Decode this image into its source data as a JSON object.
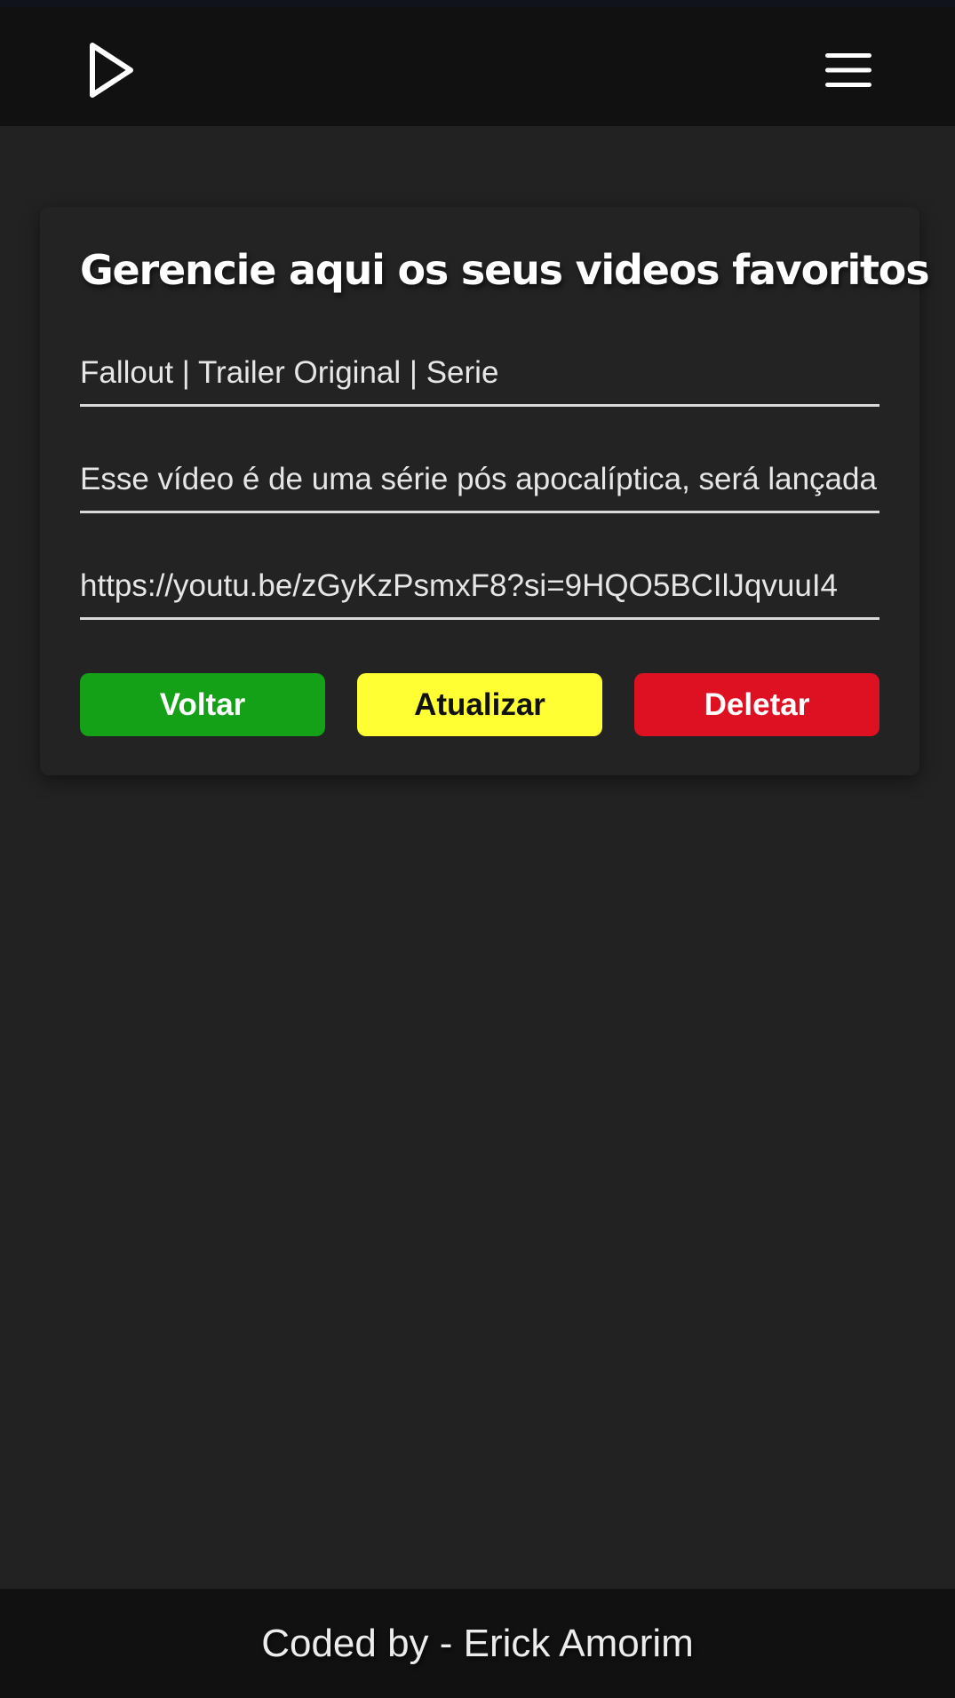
{
  "header": {
    "logo_icon": "play-icon",
    "menu_icon": "hamburger-menu-icon"
  },
  "card": {
    "title": "Gerencie aqui os seus videos favoritos",
    "fields": {
      "title_value": "Fallout | Trailer Original | Serie",
      "description_value": "Esse vídeo é de uma série pós apocalíptica, será lançada",
      "url_value": "https://youtu.be/zGyKzPsmxF8?si=9HQO5BCIlJqvuuI4"
    },
    "buttons": {
      "back_label": "Voltar",
      "update_label": "Atualizar",
      "delete_label": "Deletar"
    }
  },
  "footer": {
    "text": "Coded by - Erick Amorim"
  },
  "colors": {
    "background": "#222222",
    "header": "#111111",
    "back_button": "#14a118",
    "update_button": "#ffff33",
    "delete_button": "#dd1122"
  }
}
